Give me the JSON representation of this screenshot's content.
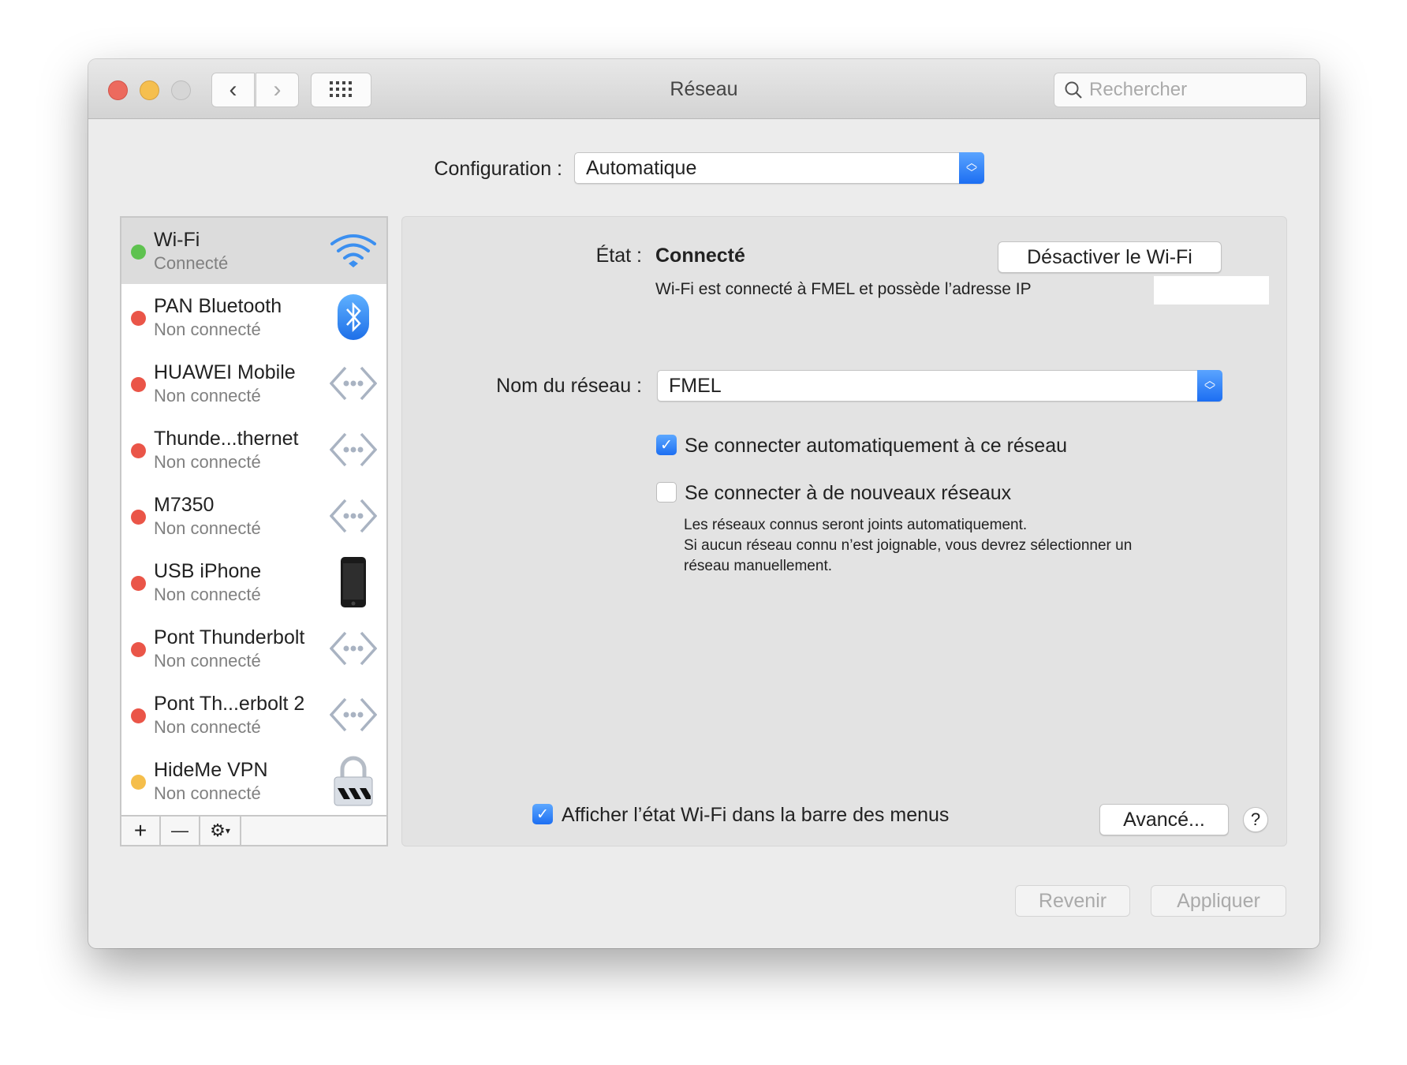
{
  "window": {
    "title": "Réseau",
    "search_placeholder": "Rechercher"
  },
  "config": {
    "label": "Configuration :",
    "value": "Automatique"
  },
  "services": [
    {
      "name": "Wi-Fi",
      "status": "Connecté",
      "state": "connected",
      "icon": "wifi-icon"
    },
    {
      "name": "PAN Bluetooth",
      "status": "Non connecté",
      "state": "disconnected",
      "icon": "bluetooth-icon"
    },
    {
      "name": "HUAWEI Mobile",
      "status": "Non connecté",
      "state": "disconnected",
      "icon": "ethernet-icon"
    },
    {
      "name": "Thunde...thernet",
      "status": "Non connecté",
      "state": "disconnected",
      "icon": "ethernet-icon"
    },
    {
      "name": "M7350",
      "status": "Non connecté",
      "state": "disconnected",
      "icon": "ethernet-icon"
    },
    {
      "name": "USB iPhone",
      "status": "Non connecté",
      "state": "disconnected",
      "icon": "iphone-icon"
    },
    {
      "name": "Pont Thunderbolt",
      "status": "Non connecté",
      "state": "disconnected",
      "icon": "ethernet-icon"
    },
    {
      "name": "Pont Th...erbolt 2",
      "status": "Non connecté",
      "state": "disconnected",
      "icon": "ethernet-icon"
    },
    {
      "name": "HideMe VPN",
      "status": "Non connecté",
      "state": "inactive",
      "icon": "vpn-lock-icon"
    }
  ],
  "list_toolbar": {
    "add": "+",
    "remove": "—"
  },
  "colors": {
    "connected": "#5ec24f",
    "disconnected": "#ea5548",
    "inactive": "#f5be4b",
    "accent": "#1d6ff2"
  },
  "detail": {
    "state_label": "État :",
    "state_value": "Connecté",
    "toggle_wifi": "Désactiver le Wi-Fi",
    "info": "Wi-Fi est connecté à FMEL et possède l’adresse IP",
    "network_label": "Nom du réseau :",
    "network_value": "FMEL",
    "auto_join": {
      "label": "Se connecter automatiquement à ce réseau",
      "checked": true
    },
    "ask_join": {
      "label": "Se connecter à de nouveaux réseaux",
      "checked": false
    },
    "help_lines": [
      "Les réseaux connus seront joints automatiquement.",
      "Si aucun réseau connu n’est joignable, vous devrez sélectionner un",
      "réseau manuellement."
    ],
    "show_menu": {
      "label": "Afficher l’état Wi-Fi dans la barre des menus",
      "checked": true
    },
    "advanced": "Avancé...",
    "help": "?"
  },
  "footer": {
    "revert": "Revenir",
    "apply": "Appliquer"
  }
}
